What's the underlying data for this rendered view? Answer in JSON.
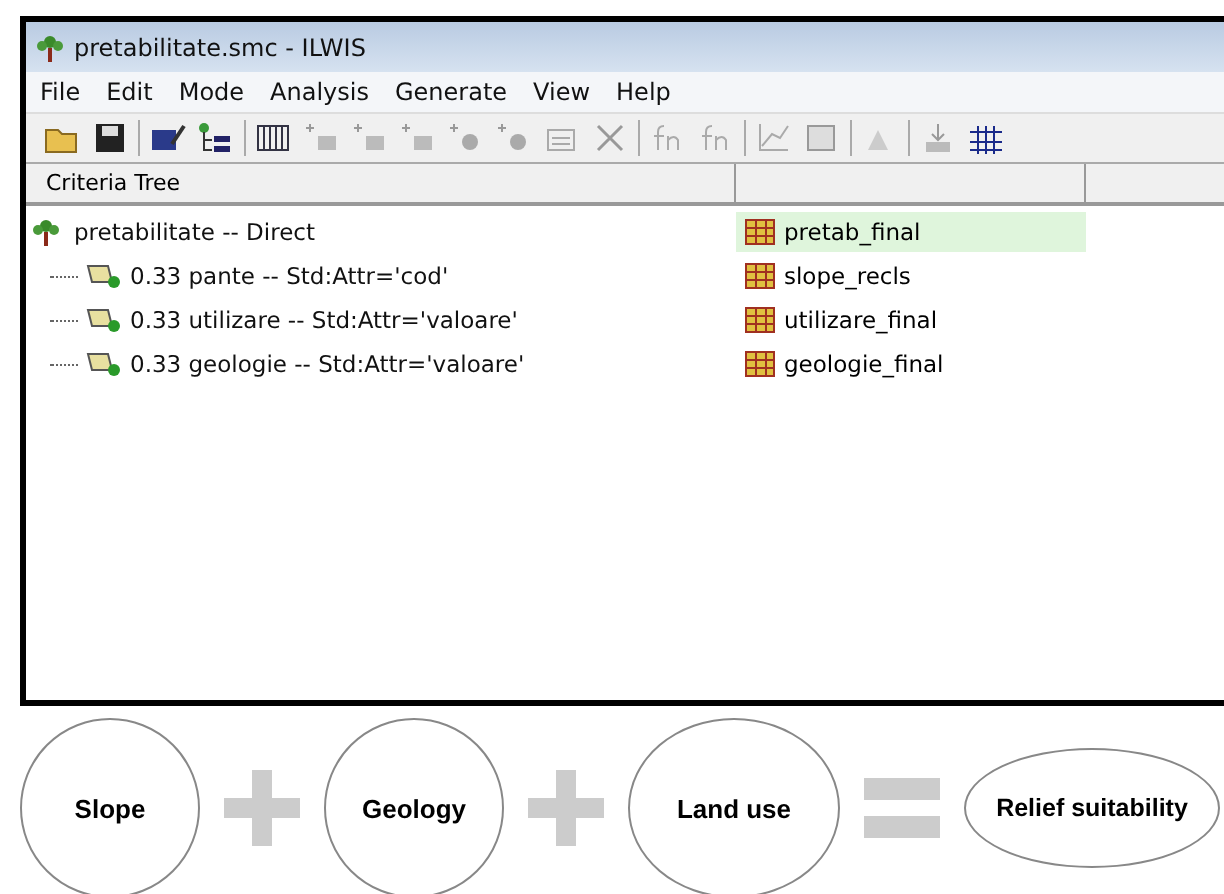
{
  "window": {
    "title": "pretabilitate.smc - ILWIS"
  },
  "menu": [
    "File",
    "Edit",
    "Mode",
    "Analysis",
    "Generate",
    "View",
    "Help"
  ],
  "tree": {
    "columns": [
      "Criteria Tree"
    ],
    "root": {
      "label": "pretabilitate -- Direct",
      "output": "pretab_final",
      "selected": true,
      "children": [
        {
          "label": "0.33 pante -- Std:Attr='cod'",
          "output": "slope_recls",
          "selected": false
        },
        {
          "label": "0.33 utilizare -- Std:Attr='valoare'",
          "output": "utilizare_final",
          "selected": false
        },
        {
          "label": "0.33 geologie -- Std:Attr='valoare'",
          "output": "geologie_final",
          "selected": false
        }
      ]
    }
  },
  "diagram": [
    {
      "kind": "circle",
      "label": "Slope"
    },
    {
      "kind": "plus"
    },
    {
      "kind": "circle",
      "label": "Geology"
    },
    {
      "kind": "plus"
    },
    {
      "kind": "circle",
      "label": "Land use"
    },
    {
      "kind": "equals"
    },
    {
      "kind": "ellipse",
      "label": "Relief suitability"
    }
  ]
}
